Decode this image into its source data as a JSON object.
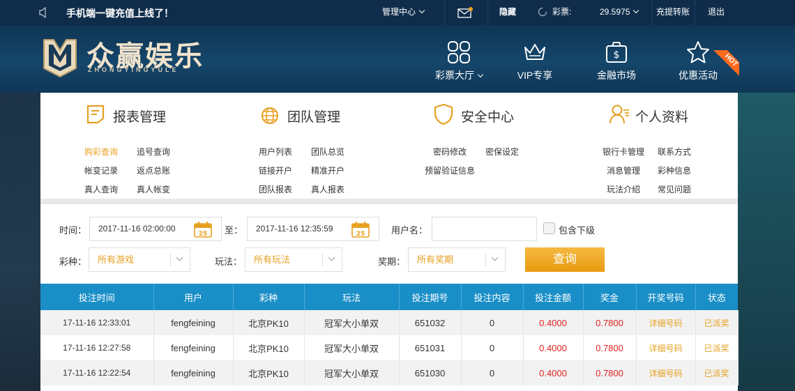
{
  "topbar": {
    "notice": "手机端一键充值上线了！",
    "admin_center": "管理中心",
    "hide": "隐藏",
    "lottery_label": "彩票:",
    "balance": "29.5975",
    "transfer": "充提转账",
    "logout": "退出"
  },
  "header": {
    "brand": "众赢娱乐",
    "brand_sub": "ZHONGYINGYULE",
    "nav": [
      {
        "label": "彩票大厅",
        "icon": "grid-icon"
      },
      {
        "label": "VIP专享",
        "icon": "crown-icon"
      },
      {
        "label": "金融市场",
        "icon": "money-bag-icon"
      },
      {
        "label": "优惠活动",
        "icon": "star-icon"
      }
    ],
    "hot_badge": "HOT"
  },
  "menu": {
    "report": {
      "title": "报表管理",
      "links": [
        "购彩查询",
        "追号查询",
        "帐变记录",
        "返点总账",
        "真人查询",
        "真人帐变"
      ]
    },
    "team": {
      "title": "团队管理",
      "links": [
        "用户列表",
        "团队总览",
        "链接开户",
        "精准开户",
        "团队报表",
        "真人报表"
      ]
    },
    "security": {
      "title": "安全中心",
      "links": [
        "密码修改",
        "密保设定",
        "预留验证信息"
      ]
    },
    "profile": {
      "title": "个人资料",
      "links": [
        "银行卡管理",
        "联系方式",
        "消息管理",
        "彩种信息",
        "玩法介绍",
        "常见问题"
      ]
    }
  },
  "filter": {
    "time_label": "时间：",
    "start_time": "2017-11-16 02:00:00",
    "to_label": "至：",
    "end_time": "2017-11-16 12:35:59",
    "username_label": "用户名：",
    "username_value": "",
    "include_sub_label": "包含下级",
    "lottery_label": "彩种：",
    "lottery_value": "所有游戏",
    "play_label": "玩法：",
    "play_value": "所有玩法",
    "period_label": "奖期：",
    "period_value": "所有奖期",
    "query_button": "查询",
    "calendar_day": "25"
  },
  "table": {
    "headers": [
      "投注时间",
      "用户",
      "彩种",
      "玩法",
      "投注期号",
      "投注内容",
      "投注金额",
      "奖金",
      "开奖号码",
      "状态"
    ],
    "rows": [
      {
        "time": "17-11-16 12:33:01",
        "user": "fengfeining",
        "lottery": "北京PK10",
        "play": "冠军大小单双",
        "period": "651032",
        "content": "0",
        "amount": "0.4000",
        "prize": "0.7800",
        "numbers": "详细号码",
        "status": "已派奖"
      },
      {
        "time": "17-11-16 12:27:58",
        "user": "fengfeining",
        "lottery": "北京PK10",
        "play": "冠军大小单双",
        "period": "651031",
        "content": "0",
        "amount": "0.4000",
        "prize": "0.7800",
        "numbers": "详细号码",
        "status": "已派奖"
      },
      {
        "time": "17-11-16 12:22:54",
        "user": "fengfeining",
        "lottery": "北京PK10",
        "play": "冠军大小单双",
        "period": "651030",
        "content": "0",
        "amount": "0.4000",
        "prize": "0.7800",
        "numbers": "详细号码",
        "status": "已派奖"
      }
    ]
  },
  "colors": {
    "accent": "#e6a020",
    "table_header": "#1a8fc7",
    "money": "#e02020",
    "topbar": "#0f2d4b"
  }
}
